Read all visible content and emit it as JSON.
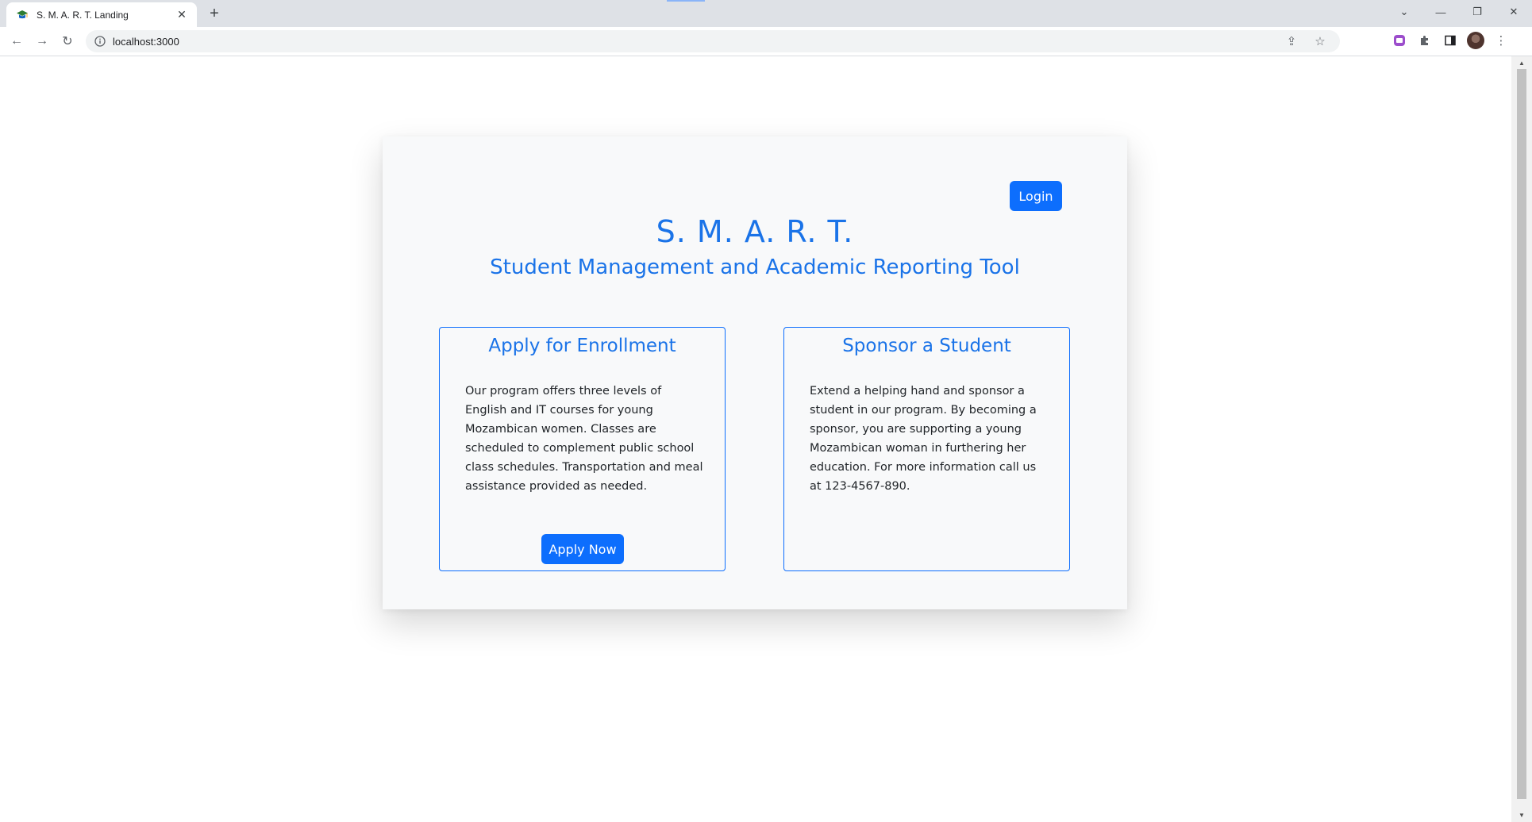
{
  "browser": {
    "tab_title": "S. M. A. R. T. Landing",
    "url": "localhost:3000",
    "icons": {
      "favicon": "graduation-cap-icon",
      "close": "close-icon",
      "new_tab": "plus-icon",
      "back": "arrow-left-icon",
      "forward": "arrow-right-icon",
      "reload": "reload-icon",
      "info": "info-icon",
      "share": "share-icon",
      "bookmark": "star-icon",
      "extension_app": "extension-app-icon",
      "extensions": "puzzle-icon",
      "side_panel": "side-panel-icon",
      "profile": "avatar",
      "menu": "kebab-menu-icon"
    }
  },
  "page": {
    "login_label": "Login",
    "title": "S. M. A. R. T.",
    "subtitle": "Student Management and Academic Reporting Tool",
    "enroll": {
      "title": "Apply for Enrollment",
      "text": "Our program offers three levels of English and IT courses for young Mozambican women. Classes are scheduled to complement public school class schedules. Transportation and meal assistance provided as needed.",
      "button_label": "Apply Now"
    },
    "sponsor": {
      "title": "Sponsor a Student",
      "text": "Extend a helping hand and sponsor a student in our program. By becoming a sponsor, you are supporting a young Mozambican woman in furthering her education. For more information call us at 123-4567-890."
    }
  },
  "colors": {
    "primary": "#0d6efd",
    "heading": "#1a73e8",
    "card_bg": "#f8f9fa"
  }
}
